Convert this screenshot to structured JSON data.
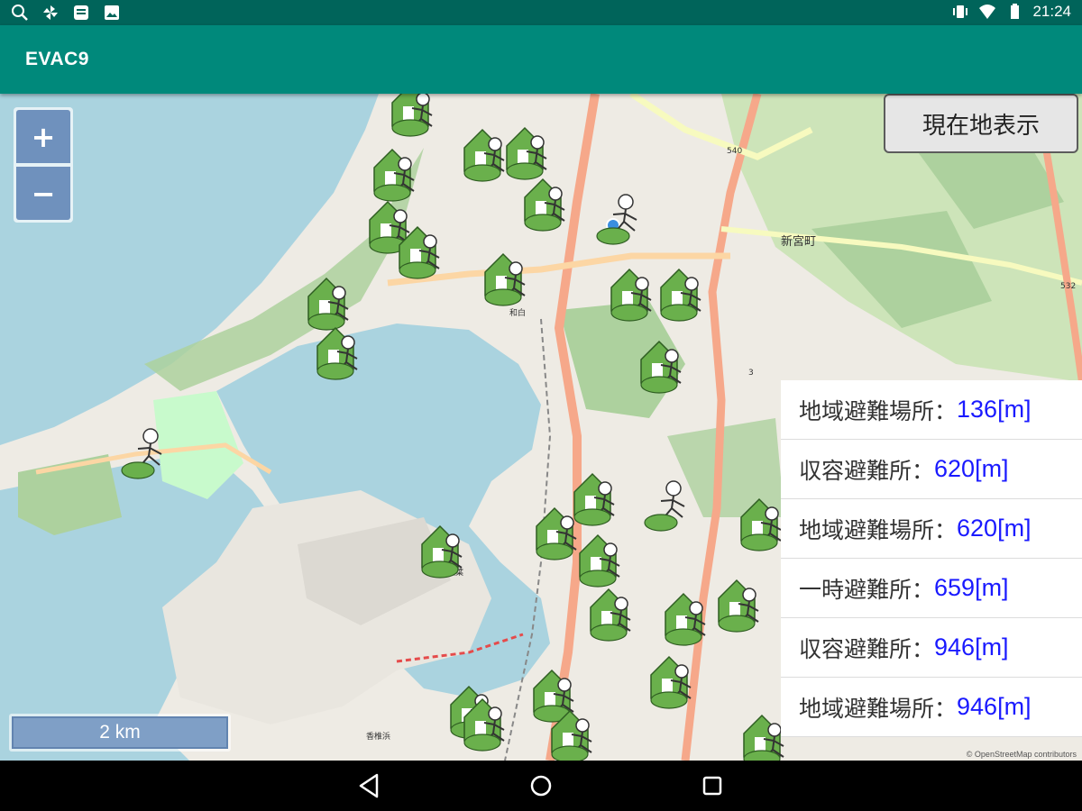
{
  "status_bar": {
    "time": "21:24",
    "left_icons": [
      "search-icon",
      "pinwheel-icon",
      "browser-icon",
      "image-icon"
    ],
    "right_icons": [
      "vibrate-icon",
      "wifi-icon",
      "battery-icon"
    ]
  },
  "app": {
    "title": "EVAC9"
  },
  "map": {
    "zoom_in_label": "+",
    "zoom_out_label": "−",
    "current_location_button": "現在地表示",
    "scale_label": "2 km",
    "attribution": "© OpenStreetMap contributors",
    "place_labels": [
      "新宮町",
      "540",
      "532",
      "3",
      "和白",
      "香椎照葉",
      "香椎浜"
    ]
  },
  "results": [
    {
      "type": "地域避難場所：",
      "distance": "136[m]"
    },
    {
      "type": "収容避難所：",
      "distance": "620[m]"
    },
    {
      "type": "地域避難場所：",
      "distance": "620[m]"
    },
    {
      "type": "一時避難所：",
      "distance": "659[m]"
    },
    {
      "type": "収容避難所：",
      "distance": "946[m]"
    },
    {
      "type": "地域避難場所：",
      "distance": "946[m]"
    }
  ],
  "colors": {
    "status_bar": "#00645a",
    "app_bar": "#00897b",
    "sea": "#aad3df",
    "distance_text": "#1a1aff",
    "marker_green": "#6ab04c",
    "zoom_button": "#6f91bd"
  }
}
